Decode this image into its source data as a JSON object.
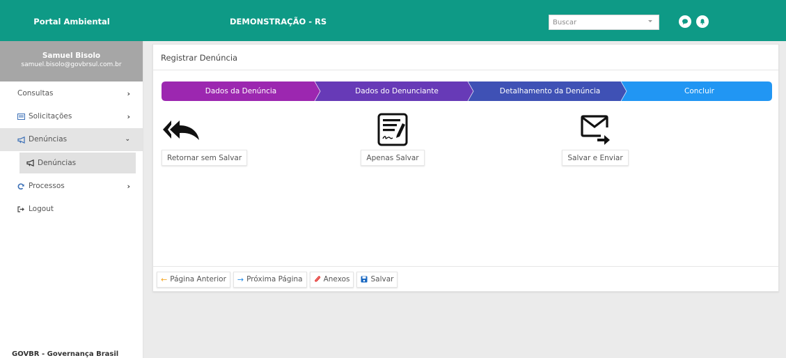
{
  "header": {
    "brand": "Portal Ambiental",
    "org": "DEMONSTRAÇÃO - RS",
    "search_placeholder": "Buscar",
    "accent": "#0e9a86"
  },
  "profile": {
    "name": "Samuel Bisolo",
    "email": "samuel.bisolo@govbrsul.com.br"
  },
  "menu": {
    "consultas": "Consultas",
    "solicitacoes": "Solicitações",
    "denuncias": "Denúncias",
    "denuncias_sub": "Denúncias",
    "processos": "Processos",
    "logout": "Logout"
  },
  "footer_text": "GOVBR - Governança Brasil",
  "card": {
    "title": "Registrar Denúncia"
  },
  "steps": [
    {
      "label": "Dados da Denúncia",
      "color": "#9c27b0"
    },
    {
      "label": "Dados do Denunciante",
      "color": "#673ab7"
    },
    {
      "label": "Detalhamento da Denúncia",
      "color": "#3f51b5"
    },
    {
      "label": "Concluir",
      "color": "#2196f3"
    }
  ],
  "actions": {
    "return": {
      "label": "Retornar sem Salvar",
      "icon": "reply-all-icon"
    },
    "save": {
      "label": "Apenas Salvar",
      "icon": "signed-document-icon"
    },
    "send": {
      "label": "Salvar e Enviar",
      "icon": "envelope-send-icon"
    }
  },
  "footer_buttons": {
    "previous": "Página Anterior",
    "next": "Próxima Página",
    "attachments": "Anexos",
    "save": "Salvar"
  }
}
